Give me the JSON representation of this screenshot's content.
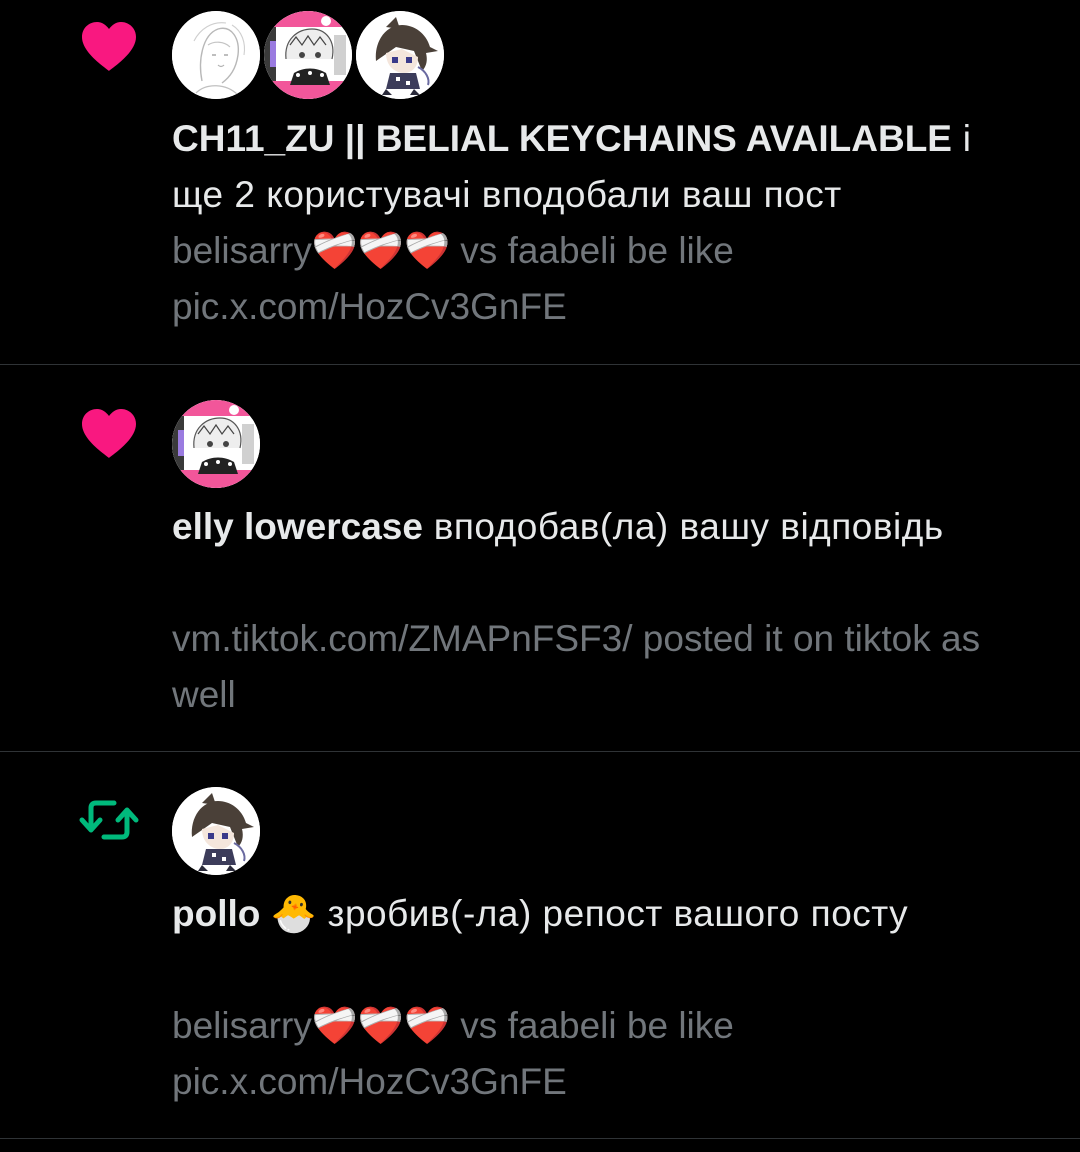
{
  "colors": {
    "background": "#000000",
    "like_pink": "#f91880",
    "repost_green": "#00ba7c",
    "primary_text": "#e7e9ea",
    "secondary_text": "#71767b",
    "divider": "#2f3336"
  },
  "notifications": [
    {
      "type": "like",
      "icon": "heart-icon",
      "avatars": [
        "avatar-sketch-portrait",
        "avatar-pink-manga",
        "avatar-chibi-character"
      ],
      "name": "CH11_ZU || BELIAL KEYCHAINS AVAILABLE",
      "action": " і ще 2 користувачі вподобали ваш пост",
      "preview": "belisarry❤️‍🩹❤️‍🩹❤️‍🩹 vs faabeli be like pic.x.com/HozCv3GnFE"
    },
    {
      "type": "like",
      "icon": "heart-icon",
      "avatars": [
        "avatar-pink-manga"
      ],
      "name": "elly lowercase",
      "action": " вподобав(ла) вашу відповідь",
      "preview": "vm.tiktok.com/ZMAPnFSF3/ posted it on tiktok as well"
    },
    {
      "type": "repost",
      "icon": "repost-icon",
      "avatars": [
        "avatar-chibi-character"
      ],
      "name": "pollo 🐣",
      "action": " зробив(-ла) репост вашого посту",
      "preview": "belisarry❤️‍🩹❤️‍🩹❤️‍🩹 vs faabeli be like pic.x.com/HozCv3GnFE"
    }
  ]
}
